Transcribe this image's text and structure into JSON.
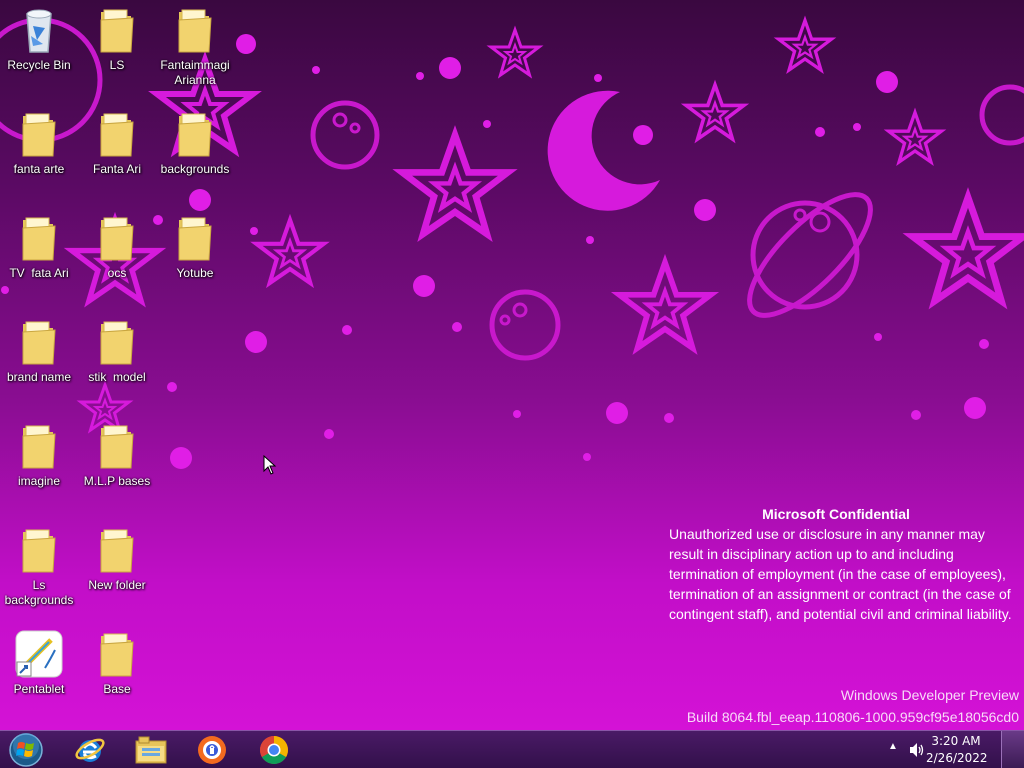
{
  "desktop": {
    "icons": [
      {
        "label": "Recycle Bin",
        "icon": "recycle-bin-icon"
      },
      {
        "label": "LS",
        "icon": "folder-icon"
      },
      {
        "label": "Fantaimmagi Arianna",
        "icon": "folder-icon"
      },
      {
        "label": "fanta arte",
        "icon": "folder-icon"
      },
      {
        "label": "Fanta Ari",
        "icon": "folder-icon"
      },
      {
        "label": "backgrounds",
        "icon": "folder-icon"
      },
      {
        "label": "TV  fata Ari",
        "icon": "folder-icon"
      },
      {
        "label": "ocs",
        "icon": "folder-icon"
      },
      {
        "label": "Yotube",
        "icon": "folder-icon"
      },
      {
        "label": "brand name",
        "icon": "folder-icon"
      },
      {
        "label": "stik  model",
        "icon": "folder-icon"
      },
      {
        "label": "imagine",
        "icon": "folder-icon"
      },
      {
        "label": "M.L.P bases",
        "icon": "folder-icon"
      },
      {
        "label": "Ls backgrounds",
        "icon": "folder-icon"
      },
      {
        "label": "New folder",
        "icon": "folder-icon"
      },
      {
        "label": "Pentablet",
        "icon": "pentablet-shortcut-icon"
      },
      {
        "label": "Base",
        "icon": "folder-icon"
      }
    ]
  },
  "watermark": {
    "title": "Microsoft Confidential",
    "body": "Unauthorized use or disclosure in any manner may result in disciplinary action up to and including termination of employment (in the case of employees), termination of an assignment or contract (in the case of contingent staff), and potential civil and criminal liability.",
    "product": "Windows Developer Preview",
    "build": "Build 8064.fbl_eeap.110806-1000.959cf95e18056cd0"
  },
  "taskbar": {
    "start_icon": "windows-start-orb-icon",
    "pinned": [
      {
        "name": "Internet Explorer",
        "icon": "internet-explorer-icon"
      },
      {
        "name": "Windows Explorer",
        "icon": "file-explorer-icon"
      },
      {
        "name": "Avast Browser",
        "icon": "avast-browser-icon"
      },
      {
        "name": "Google Chrome",
        "icon": "chrome-icon"
      }
    ],
    "tray": {
      "time": "3:20 AM",
      "date": "2/26/2022",
      "icons": [
        "show-hidden-icons-arrow",
        "volume-icon"
      ]
    }
  },
  "colors": {
    "wallpaper_top": "#3a0840",
    "wallpaper_bottom": "#d412d6",
    "pattern": "#e01ee6",
    "taskbar": "#32104a"
  }
}
